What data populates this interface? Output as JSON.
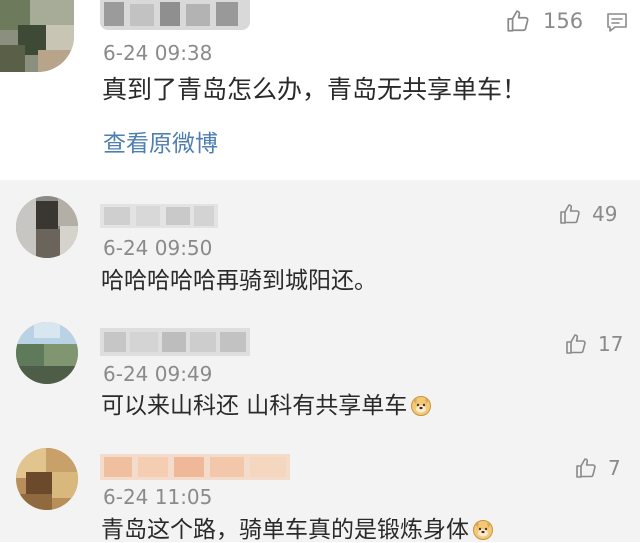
{
  "main_comment": {
    "time": "6-24 09:38",
    "text": "真到了青岛怎么办，青岛无共享单车！",
    "like_count": "156",
    "like_icon": "thumbs-up-icon",
    "reply_icon": "comment-icon",
    "view_original_link": "查看原微博"
  },
  "replies": [
    {
      "time": "6-24 09:50",
      "text": "哈哈哈哈哈再骑到城阳还。",
      "like_count": "49",
      "emoji": ""
    },
    {
      "time": "6-24 09:49",
      "text": "可以来山科还 山科有共享单车",
      "like_count": "17",
      "emoji": "doge-emoji"
    },
    {
      "time": "6-24 11:05",
      "text": "青岛这个路，骑单车真的是锻炼身体",
      "like_count": "7",
      "emoji": "doge-emoji"
    }
  ],
  "colors": {
    "meta_gray": "#8a8a8a",
    "link_blue": "#4f7fb0",
    "reply_section_bg": "#f3f3f3",
    "text_dark": "#2a2a2a"
  }
}
